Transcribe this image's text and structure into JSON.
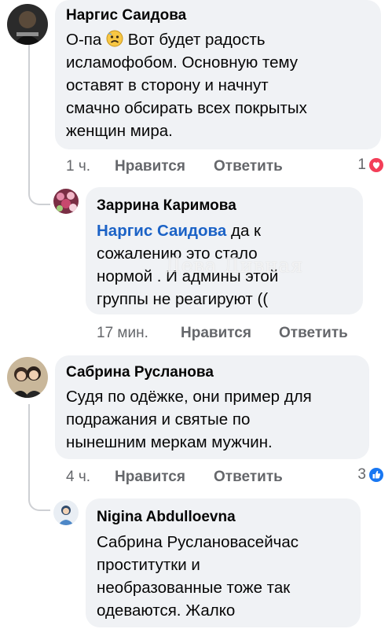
{
  "comments": [
    {
      "author": "Наргис Саидова",
      "text_lines": [
        "О-па",
        "Вот будет радость",
        "исламофобом. Основную тему",
        "оставят в сторону и начнут",
        "смачно обсирать всех покрытых",
        "женщин мира."
      ],
      "inline_emoji": "worried-face-emoji",
      "time": "1 ч.",
      "like_label": "Нравится",
      "reply_label": "Ответить",
      "reaction_count": "1",
      "reaction_icon": "love-reaction-icon",
      "reaction_color": "#f33e58"
    },
    {
      "author": "Заррина Каримова",
      "mention": "Наргис Саидова",
      "text_lines": [
        "да к",
        "сожалению это стало",
        "нормой . И админы этой",
        "группы не реагируют (("
      ],
      "time": "17 мин.",
      "like_label": "Нравится",
      "reply_label": "Ответить"
    },
    {
      "author": "Сабрина Русланова",
      "text_lines": [
        "Судя по одёжке, они пример для",
        "подражания и святые по",
        "нынешним меркам мужчин."
      ],
      "time": "4 ч.",
      "like_label": "Нравится",
      "reply_label": "Ответить",
      "reaction_count": "3",
      "reaction_icon": "like-reaction-icon",
      "reaction_color": "#1877f2"
    },
    {
      "author": "Nigina Abdulloevna",
      "text_lines": [
        "Сабрина Руслановасейчас",
        "проститутки и",
        "необразованные тоже так",
        "одеваются. Жалко"
      ]
    }
  ],
  "watermark": "Дева Дивная",
  "colors": {
    "bubble_bg": "#f0f2f5",
    "meta_text": "#65676b",
    "mention": "#1b62c6",
    "thread_line": "#ced0d4"
  }
}
